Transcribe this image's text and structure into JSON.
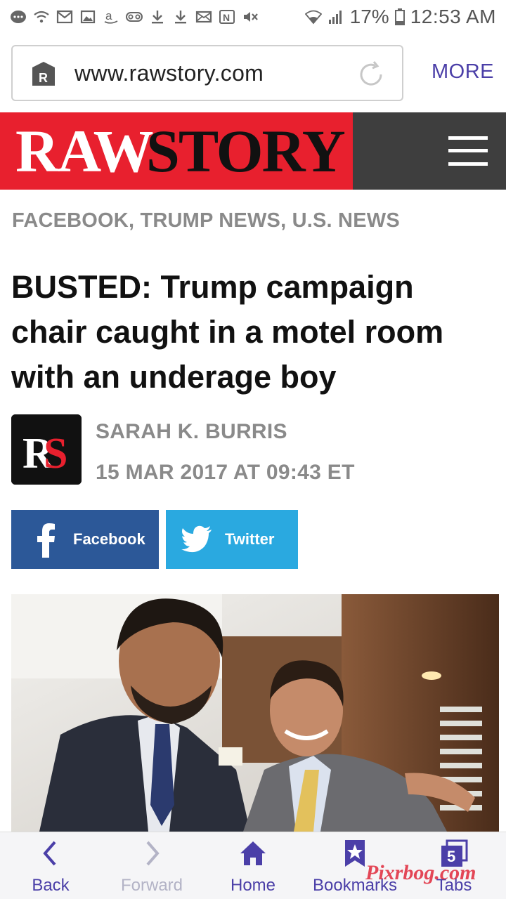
{
  "status_bar": {
    "battery": "17%",
    "time": "12:53 AM",
    "icons": [
      "messenger-icon",
      "voicemail-icon",
      "gmail-icon",
      "gallery-icon",
      "amazon-icon",
      "voicemail-tape-icon",
      "download-icon",
      "download-icon",
      "email-icon",
      "nfc-icon",
      "mute-icon",
      "wifi-icon",
      "signal-icon",
      "battery-icon"
    ]
  },
  "browser": {
    "url": "www.rawstory.com",
    "more_label": "MORE"
  },
  "site": {
    "logo_raw": "RAW",
    "logo_story": "STORY",
    "brand_red": "#e8202e",
    "header_dark": "#3e3e3e"
  },
  "article": {
    "categories": "FACEBOOK, TRUMP NEWS, U.S. NEWS",
    "headline": "BUSTED: Trump campaign chair caught in a motel room with an underage boy",
    "author": "SARAH K. BURRIS",
    "date": "15 MAR 2017 AT 09:43 ET",
    "avatar_text": "RS"
  },
  "share": {
    "facebook_label": "Facebook",
    "twitter_label": "Twitter",
    "facebook_color": "#2c5898",
    "twitter_color": "#2aa9e0"
  },
  "bottom_nav": {
    "back": "Back",
    "forward": "Forward",
    "home": "Home",
    "bookmarks": "Bookmarks",
    "tabs": "Tabs",
    "tab_count": "5",
    "accent": "#4b3fa8"
  },
  "watermark": "Pixrbog.com"
}
